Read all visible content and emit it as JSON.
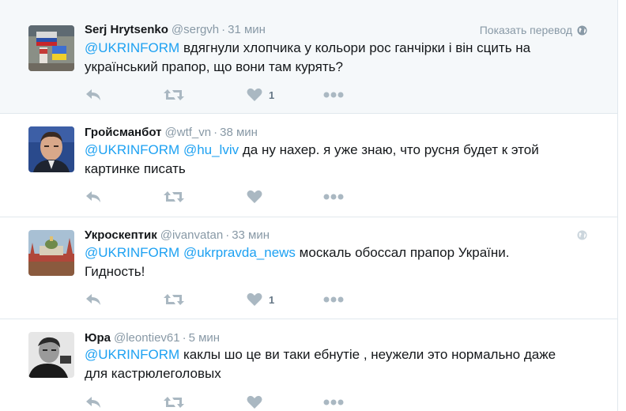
{
  "ui": {
    "translate_label": "Показать перевод"
  },
  "colors": {
    "link": "#1da1f2",
    "muted": "#8899a6",
    "icon": "#aab8c2",
    "highlight_bg": "#f5f8fa"
  },
  "tweets": [
    {
      "name": "Serj Hrytsenko",
      "handle": "@sergvh",
      "time": "31 мин",
      "mentions": [
        "@UKRINFORM"
      ],
      "text": "вдягнули хлопчика у кольори рос ганчірки і він сцить на український прапор, що вони там курять?",
      "like_count": "1",
      "show_translate": true,
      "avatar_icon": "flag-photo-icon"
    },
    {
      "name": "Гройсманбот",
      "handle": "@wtf_vn",
      "time": "38 мин",
      "mentions": [
        "@UKRINFORM",
        "@hu_lviv"
      ],
      "text": "да ну нахер. я уже знаю, что русня будет к этой картинке писать",
      "like_count": "",
      "show_translate": false,
      "avatar_icon": "portrait-man-icon"
    },
    {
      "name": "Укроскептик",
      "handle": "@ivanvatan",
      "time": "33 мин",
      "mentions": [
        "@UKRINFORM",
        "@ukrpravda_news"
      ],
      "text": "москаль обоссал прапор України. Гидность!",
      "like_count": "1",
      "show_translate": false,
      "avatar_icon": "kremlin-icon"
    },
    {
      "name": "Юра",
      "handle": "@leontiev61",
      "time": "5 мин",
      "mentions": [
        "@UKRINFORM"
      ],
      "text": "каклы шо це ви таки ебнутіе , неужели это нормально даже для кастрюлеголовых",
      "like_count": "",
      "show_translate": false,
      "avatar_icon": "bw-portrait-icon"
    }
  ]
}
